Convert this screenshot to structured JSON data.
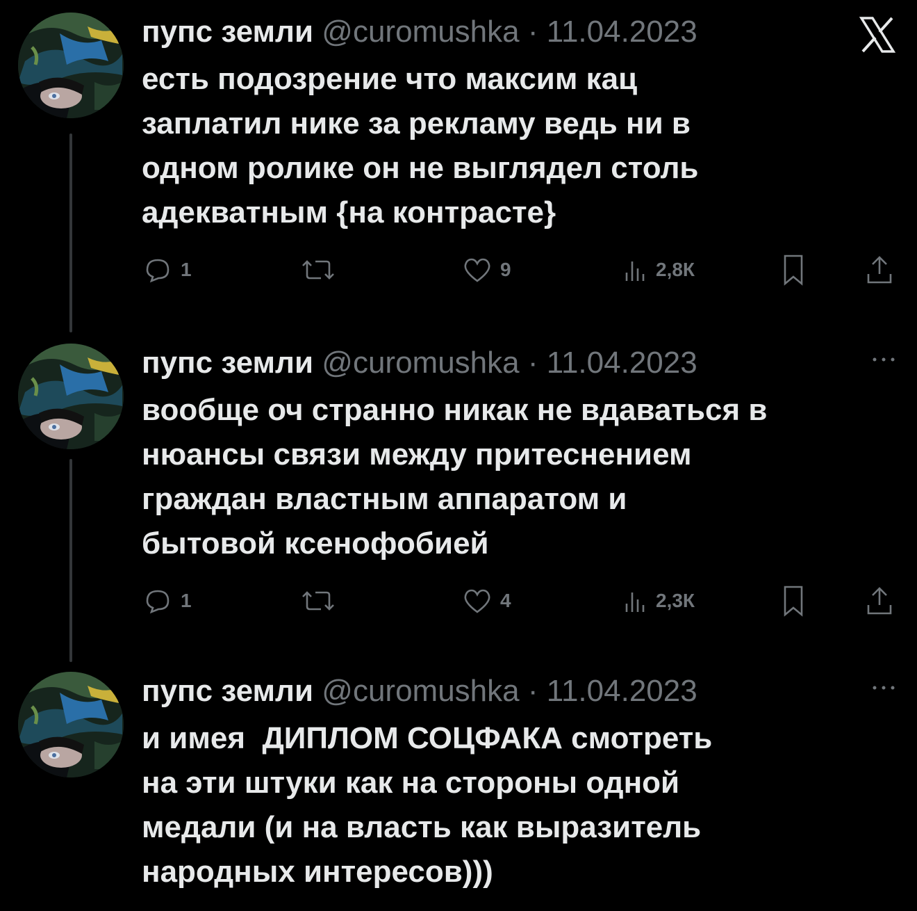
{
  "brand_icon": "x-logo-icon",
  "author": {
    "name": "пупс земли",
    "handle": "@curomushka",
    "separator": "·"
  },
  "tweets": [
    {
      "date": "11.04.2023",
      "text": "есть подозрение что максим кац\nзаплатил нике за рекламу ведь ни в\nодном ролике он не выглядел столь\nадекватным {на контрасте}",
      "replies": "1",
      "likes": "9",
      "views": "2,8К"
    },
    {
      "date": "11.04.2023",
      "text": "вообще оч странно никак не вдаваться в\nнюансы связи между притеснением\nграждан властным аппаратом и\nбытовой ксенофобией",
      "replies": "1",
      "likes": "4",
      "views": "2,3К"
    },
    {
      "date": "11.04.2023",
      "text": "и имея  ДИПЛОМ СОЦФАКА смотреть\nна эти штуки как на стороны одной\nмедали (и на власть как выразитель\nнародных интересов)))"
    }
  ],
  "more_icon": "more-dots-icon"
}
